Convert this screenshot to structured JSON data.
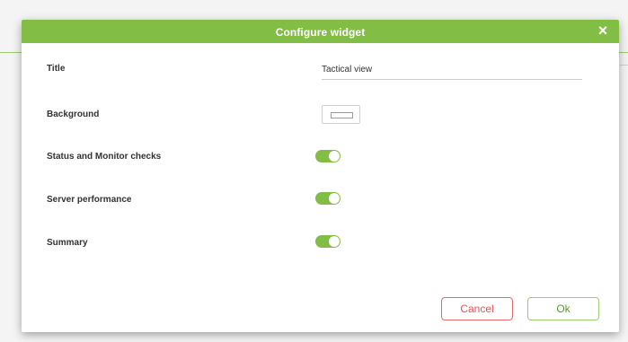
{
  "dialog": {
    "title": "Configure widget",
    "close_glyph": "×"
  },
  "fields": {
    "title_label": "Title",
    "title_value": "Tactical view",
    "background_label": "Background",
    "background_color": "#ffffff",
    "status_label": "Status and Monitor checks",
    "status_enabled": true,
    "server_label": "Server performance",
    "server_enabled": true,
    "summary_label": "Summary",
    "summary_enabled": true
  },
  "buttons": {
    "cancel_label": "Cancel",
    "ok_label": "Ok"
  },
  "colors": {
    "accent": "#82be45",
    "cancel": "#e05555",
    "ok": "#5a9a2a"
  },
  "icons": {
    "close": "close-icon",
    "toggle": "toggle-switch"
  }
}
